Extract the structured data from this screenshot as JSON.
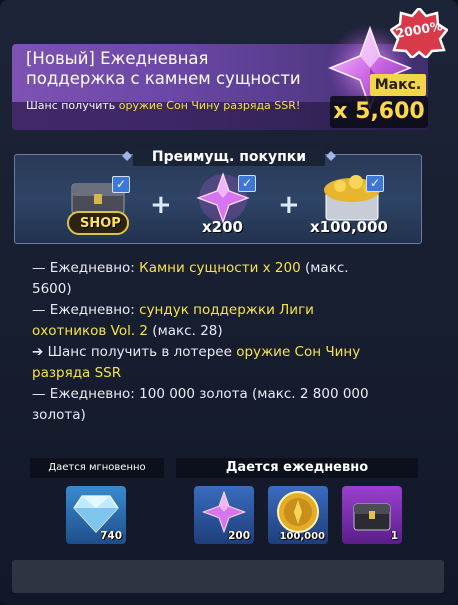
{
  "header": {
    "title_line1": "[Новый] Ежедневная",
    "title_line2": "поддержка с камнем сущности",
    "subtitle_prefix": "Шанс получить ",
    "subtitle_highlight": "оружие Сон Чину разряда SSR!",
    "badge_percent": "2000%",
    "max_label": "Макс.",
    "max_value": "x 5,600"
  },
  "benefits": {
    "title": "Преимущ. покупки",
    "items": [
      {
        "icon": "shop-chest-icon",
        "label": "SHOP"
      },
      {
        "icon": "essence-stone-icon",
        "count": "x200"
      },
      {
        "icon": "gold-chest-icon",
        "count": "x100,000"
      }
    ],
    "plus": "+"
  },
  "description": {
    "line1_prefix": "— Ежедневно: ",
    "line1_highlight": "Камни сущности x 200",
    "line1_suffix": " (макс.",
    "line1_cont": "5600)",
    "line2_prefix": "— Ежедневно: ",
    "line2_highlight": "сундук поддержки Лиги",
    "line2_cont_highlight": "охотников Vol. 2",
    "line2_cont_suffix": " (макс. 28)",
    "line3_prefix": " ➔ Шанс получить в лотерее ",
    "line3_highlight": "оружие Сон Чину",
    "line3_cont_highlight": "разряда SSR",
    "line4": "— Ежедневно: 100 000 золота (макс. 2 800 000",
    "line4_cont": "золота)"
  },
  "rewards": {
    "instant_label": "Дается мгновенно",
    "daily_label": "Дается ежедневно",
    "instant": [
      {
        "icon": "diamond-icon",
        "count": "740"
      }
    ],
    "daily": [
      {
        "icon": "essence-stone-icon",
        "count": "200"
      },
      {
        "icon": "gold-coin-icon",
        "count": "100,000"
      },
      {
        "icon": "support-chest-icon",
        "count": "1"
      }
    ]
  },
  "colors": {
    "accent_yellow": "#f6e24a",
    "header_purple": "#7d52b3",
    "badge_red": "#d83a4a"
  }
}
